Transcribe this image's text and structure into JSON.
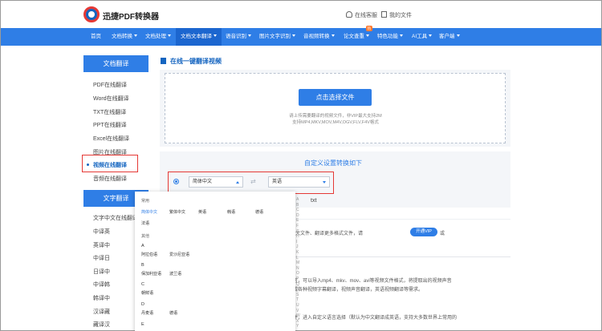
{
  "header": {
    "brand": "迅捷PDF转换器",
    "service": "在线客服",
    "my_files": "我的文件"
  },
  "nav": {
    "items": [
      {
        "label": "首页",
        "dropdown": false
      },
      {
        "label": "文档转换",
        "dropdown": true
      },
      {
        "label": "文档处理",
        "dropdown": true
      },
      {
        "label": "文档文本翻译",
        "dropdown": true
      },
      {
        "label": "语音识别",
        "dropdown": true
      },
      {
        "label": "图片文字识别",
        "dropdown": true
      },
      {
        "label": "音视频转换",
        "dropdown": true
      },
      {
        "label": "论文查重",
        "dropdown": true,
        "badge": "热"
      },
      {
        "label": "特色功能",
        "dropdown": true
      },
      {
        "label": "AI工具",
        "dropdown": true
      },
      {
        "label": "客户端",
        "dropdown": true
      }
    ]
  },
  "sidebar": {
    "doc_heading": "文档翻译",
    "doc_items": [
      "PDF在线翻译",
      "Word在线翻译",
      "TXT在线翻译",
      "PPT在线翻译",
      "Excel在线翻译",
      "图片在线翻译",
      "视频在线翻译",
      "音频在线翻译"
    ],
    "text_heading": "文字翻译",
    "text_items": [
      "文字中文在线翻译",
      "中译英",
      "英译中",
      "中译日",
      "日译中",
      "中译韩",
      "韩译中",
      "汉译藏",
      "藏译汉"
    ]
  },
  "main": {
    "title": "在线一键翻译视频",
    "upload_button": "点击选择文件",
    "hint_line1": "请上传需要翻译的视频文件，非VIP最大支持2M",
    "hint_line2": "支持MP4,MKV,MOV,M4V,OGV,FLV,F4V格式",
    "settings_title": "自定义设置转换如下",
    "source_lang": "简体中文",
    "target_lang": "英语",
    "output_format": "txt",
    "vip_text": "翻译更大文件、翻译更多格式文件，请",
    "vip_button": "开通VIP",
    "vip_tail": "或",
    "para1_line1": "语言，可以导入mp4、mkv、mov、avi等视频文件格式，将提取出的视频声音",
    "para1_line2": "完成各种视频字幕翻译，视频声音翻译，英语视频翻译等需求。",
    "para2_line1": "文件，进入自定义语言选择（默认为中文翻译成英语，支持大多数世界上常用的"
  },
  "dropdown": {
    "common_heading": "常用",
    "common_row1": [
      "简体中文",
      "繁体中文",
      "英语",
      "韩语",
      "德语"
    ],
    "common_row2": [
      "法语"
    ],
    "other_heading": "其他",
    "groups": [
      {
        "letter": "A",
        "options": [
          "阿拉伯语",
          "爱沙尼亚语"
        ]
      },
      {
        "letter": "B",
        "options": [
          "保加利亚语",
          "波兰语"
        ]
      },
      {
        "letter": "C",
        "options": [
          "朝鲜语"
        ]
      },
      {
        "letter": "D",
        "options": [
          "丹麦语",
          "德语"
        ]
      },
      {
        "letter": "E",
        "options": []
      }
    ],
    "alphabet": [
      "A",
      "B",
      "C",
      "D",
      "E",
      "F",
      "G",
      "H",
      "I",
      "J",
      "K",
      "L",
      "M",
      "N",
      "O",
      "P",
      "Q",
      "R",
      "S",
      "T",
      "U",
      "V",
      "W",
      "X",
      "Y"
    ]
  },
  "colors": {
    "primary": "#2f7ee6",
    "highlight_box": "#e53935"
  }
}
